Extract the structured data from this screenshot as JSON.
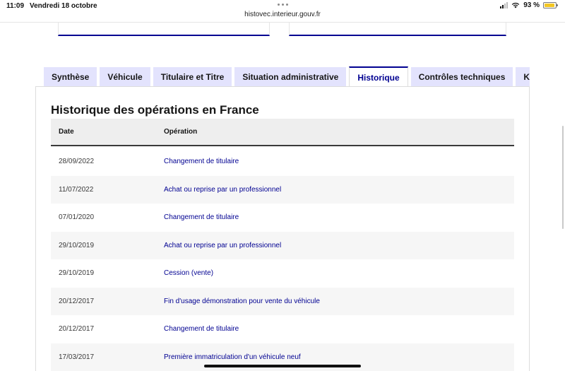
{
  "status": {
    "time": "11:09",
    "date": "Vendredi 18 octobre",
    "battery": "93 %",
    "battery_level": 0.93
  },
  "browser": {
    "url": "histovec.interieur.gouv.fr"
  },
  "tabs": [
    {
      "label": "Synthèse",
      "active": false
    },
    {
      "label": "Véhicule",
      "active": false
    },
    {
      "label": "Titulaire et Titre",
      "active": false
    },
    {
      "label": "Situation administrative",
      "active": false
    },
    {
      "label": "Historique",
      "active": true
    },
    {
      "label": "Contrôles techniques",
      "active": false
    },
    {
      "label": "Kilométrage",
      "active": false
    }
  ],
  "section": {
    "title": "Historique des opérations en France"
  },
  "table": {
    "headers": {
      "date": "Date",
      "operation": "Opération"
    },
    "rows": [
      {
        "date": "28/09/2022",
        "operation": "Changement de titulaire"
      },
      {
        "date": "11/07/2022",
        "operation": "Achat ou reprise par un professionnel"
      },
      {
        "date": "07/01/2020",
        "operation": "Changement de titulaire"
      },
      {
        "date": "29/10/2019",
        "operation": "Achat ou reprise par un professionnel"
      },
      {
        "date": "29/10/2019",
        "operation": "Cession (vente)"
      },
      {
        "date": "20/12/2017",
        "operation": "Fin d'usage démonstration pour vente du véhicule"
      },
      {
        "date": "20/12/2017",
        "operation": "Changement de titulaire"
      },
      {
        "date": "17/03/2017",
        "operation": "Première immatriculation d'un véhicule neuf"
      }
    ]
  },
  "colors": {
    "accent": "#000091",
    "tab_bg": "#e3e3fd",
    "header_bg": "#eeeeee"
  }
}
